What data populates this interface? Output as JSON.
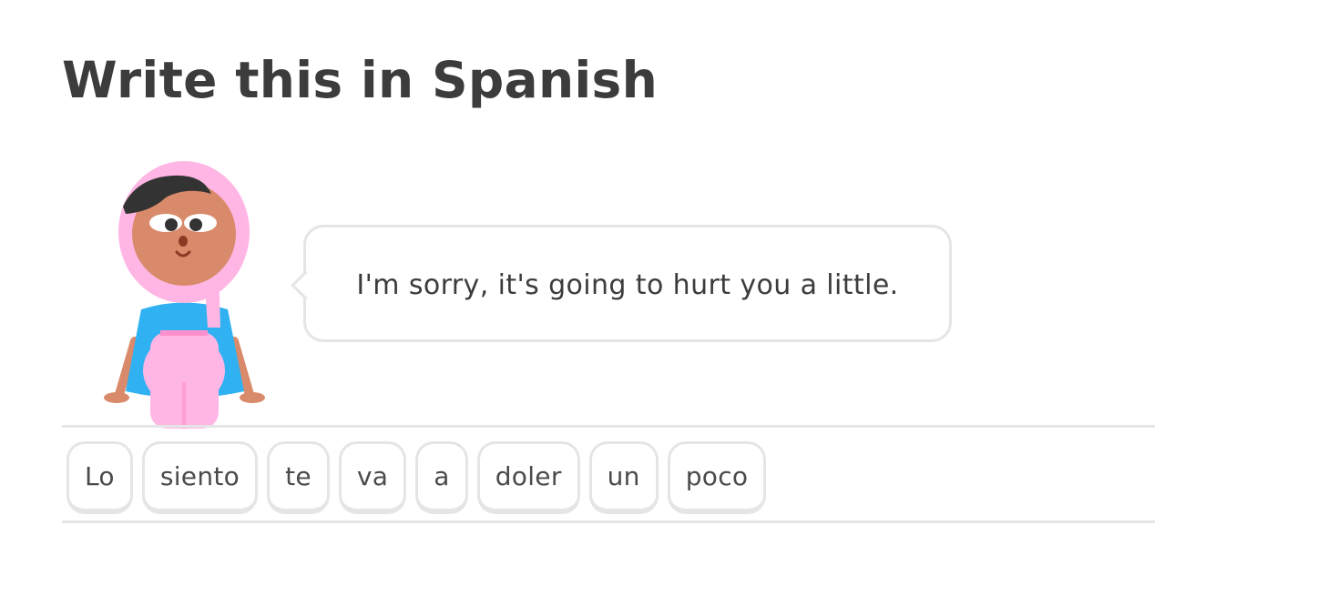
{
  "challenge": {
    "title": "Write this in Spanish",
    "prompt": "I'm sorry, it's going to hurt you a little."
  },
  "character": {
    "icon": "character-avatar-icon",
    "colors": {
      "hijab": "#ffb6e4",
      "skin": "#d98a6a",
      "hair": "#333333",
      "shirt": "#2fb1f2",
      "pants": "#ffb6e4"
    }
  },
  "word_bank": [
    {
      "label": "Lo"
    },
    {
      "label": "siento"
    },
    {
      "label": "te"
    },
    {
      "label": "va"
    },
    {
      "label": "a"
    },
    {
      "label": "doler"
    },
    {
      "label": "un"
    },
    {
      "label": "poco"
    }
  ],
  "colors": {
    "text": "#3c3c3c",
    "border": "#e5e5e5",
    "background": "#ffffff"
  }
}
